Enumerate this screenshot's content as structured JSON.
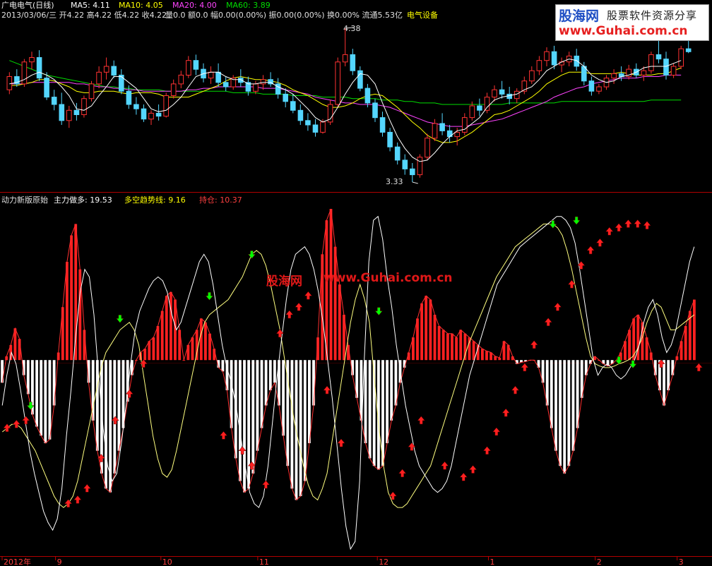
{
  "main_header": {
    "stock": "广电电气(日线)",
    "ma5_label": "MA5: 4.11",
    "ma10_label": "MA10: 4.05",
    "ma20_label": "MA20: 4.00",
    "ma60_label": "MA60: 3.89",
    "ohlc": "2013/03/06/三 开4.22 高4.22 低4.22 收4.22",
    "vol": "量0.0 额0.0 幅0.00(0.00%) 振0.00(0.00%) 换0.00% 流通5.53亿",
    "sector": "电气设备"
  },
  "price_annotations": {
    "high": "4.38",
    "low": "3.33"
  },
  "indicator_header": {
    "name": "动力新版原始",
    "main_label": "主力做多: 19.53",
    "trend_label": "多空趋势线: 9.16",
    "hold_label": "持仓: 10.37"
  },
  "watermark": {
    "cn": "股海网",
    "url": "www.Guhai.com.cn"
  },
  "logo": {
    "main": "股海网",
    "sub": "股票软件资源分享",
    "url": "www.Guhai.com.cn"
  },
  "colors": {
    "background": "#000000",
    "bull": "#ff3232",
    "bear": "#54d6ff",
    "ma5": "#ffffff",
    "ma10": "#ffff00",
    "ma20": "#ff44ff",
    "ma60": "#00dd00",
    "bar_pos": "#ff2020",
    "bar_neg": "#ffffff",
    "buy_arrow": "#ff2020",
    "sell_arrow": "#00ff00",
    "axis": "#c00000"
  },
  "chart_data": {
    "type": "line",
    "price_range": [
      3.33,
      4.38
    ],
    "x_axis_labels": [
      "2012年",
      "9",
      "10",
      "11",
      "12",
      "1",
      "2",
      "3"
    ],
    "candles": [
      [
        3.96,
        4.08,
        3.93,
        4.05
      ],
      [
        4.05,
        4.1,
        3.98,
        4.0
      ],
      [
        4.0,
        4.17,
        3.98,
        4.15
      ],
      [
        4.15,
        4.22,
        4.1,
        4.18
      ],
      [
        4.18,
        4.23,
        4.02,
        4.04
      ],
      [
        4.04,
        4.08,
        3.89,
        3.91
      ],
      [
        3.91,
        3.96,
        3.82,
        3.86
      ],
      [
        3.86,
        3.94,
        3.72,
        3.75
      ],
      [
        3.75,
        3.85,
        3.7,
        3.82
      ],
      [
        3.82,
        3.87,
        3.75,
        3.79
      ],
      [
        3.79,
        3.92,
        3.77,
        3.9
      ],
      [
        3.9,
        4.02,
        3.88,
        4.0
      ],
      [
        4.0,
        4.12,
        3.97,
        4.08
      ],
      [
        4.08,
        4.18,
        4.03,
        4.12
      ],
      [
        4.12,
        4.16,
        4.04,
        4.06
      ],
      [
        4.06,
        4.1,
        3.93,
        3.95
      ],
      [
        3.95,
        3.99,
        3.83,
        3.86
      ],
      [
        3.86,
        3.91,
        3.79,
        3.83
      ],
      [
        3.83,
        3.86,
        3.74,
        3.76
      ],
      [
        3.76,
        3.82,
        3.72,
        3.8
      ],
      [
        3.8,
        3.86,
        3.75,
        3.78
      ],
      [
        3.78,
        3.94,
        3.77,
        3.92
      ],
      [
        3.92,
        4.03,
        3.9,
        4.0
      ],
      [
        4.0,
        4.09,
        3.97,
        4.06
      ],
      [
        4.06,
        4.19,
        4.04,
        4.16
      ],
      [
        4.16,
        4.2,
        4.06,
        4.1
      ],
      [
        4.1,
        4.14,
        4.01,
        4.04
      ],
      [
        4.04,
        4.12,
        4.0,
        4.08
      ],
      [
        4.08,
        4.14,
        3.98,
        4.01
      ],
      [
        4.01,
        4.05,
        3.95,
        3.98
      ],
      [
        3.98,
        4.06,
        3.96,
        4.04
      ],
      [
        4.04,
        4.1,
        3.98,
        4.01
      ],
      [
        4.01,
        4.05,
        3.92,
        3.95
      ],
      [
        3.95,
        4.02,
        3.93,
        4.0
      ],
      [
        4.0,
        4.06,
        3.96,
        4.03
      ],
      [
        4.03,
        4.08,
        3.98,
        4.0
      ],
      [
        4.0,
        4.04,
        3.9,
        3.93
      ],
      [
        3.93,
        3.97,
        3.84,
        3.88
      ],
      [
        3.88,
        3.93,
        3.8,
        3.82
      ],
      [
        3.82,
        3.86,
        3.72,
        3.75
      ],
      [
        3.75,
        3.8,
        3.68,
        3.72
      ],
      [
        3.72,
        3.76,
        3.64,
        3.67
      ],
      [
        3.67,
        3.76,
        3.66,
        3.74
      ],
      [
        3.74,
        3.89,
        3.72,
        3.86
      ],
      [
        3.86,
        4.18,
        3.84,
        4.15
      ],
      [
        4.15,
        4.38,
        4.12,
        4.2
      ],
      [
        4.2,
        4.24,
        4.06,
        4.09
      ],
      [
        4.09,
        4.12,
        3.95,
        3.97
      ],
      [
        3.97,
        4.0,
        3.84,
        3.87
      ],
      [
        3.87,
        3.9,
        3.74,
        3.77
      ],
      [
        3.77,
        3.81,
        3.64,
        3.67
      ],
      [
        3.67,
        3.7,
        3.54,
        3.57
      ],
      [
        3.57,
        3.6,
        3.45,
        3.48
      ],
      [
        3.48,
        3.52,
        3.38,
        3.42
      ],
      [
        3.42,
        3.46,
        3.33,
        3.38
      ],
      [
        3.38,
        3.52,
        3.36,
        3.5
      ],
      [
        3.5,
        3.66,
        3.48,
        3.63
      ],
      [
        3.63,
        3.76,
        3.61,
        3.73
      ],
      [
        3.73,
        3.8,
        3.65,
        3.68
      ],
      [
        3.68,
        3.72,
        3.6,
        3.64
      ],
      [
        3.64,
        3.7,
        3.58,
        3.67
      ],
      [
        3.67,
        3.8,
        3.65,
        3.77
      ],
      [
        3.77,
        3.88,
        3.75,
        3.85
      ],
      [
        3.85,
        3.9,
        3.78,
        3.82
      ],
      [
        3.82,
        3.94,
        3.8,
        3.91
      ],
      [
        3.91,
        3.99,
        3.88,
        3.96
      ],
      [
        3.96,
        4.02,
        3.9,
        3.93
      ],
      [
        3.93,
        3.98,
        3.86,
        3.9
      ],
      [
        3.9,
        3.97,
        3.87,
        3.95
      ],
      [
        3.95,
        4.05,
        3.93,
        4.02
      ],
      [
        4.02,
        4.12,
        4.0,
        4.09
      ],
      [
        4.09,
        4.19,
        4.06,
        4.16
      ],
      [
        4.16,
        4.25,
        4.12,
        4.22
      ],
      [
        4.22,
        4.26,
        4.1,
        4.13
      ],
      [
        4.13,
        4.18,
        4.08,
        4.15
      ],
      [
        4.15,
        4.22,
        4.12,
        4.19
      ],
      [
        4.19,
        4.24,
        4.09,
        4.12
      ],
      [
        4.12,
        4.15,
        3.99,
        4.02
      ],
      [
        4.02,
        4.05,
        3.92,
        3.95
      ],
      [
        3.95,
        4.0,
        3.93,
        3.98
      ],
      [
        3.98,
        4.06,
        3.96,
        4.04
      ],
      [
        4.04,
        4.1,
        4.0,
        4.07
      ],
      [
        4.07,
        4.12,
        4.02,
        4.05
      ],
      [
        4.05,
        4.13,
        4.03,
        4.1
      ],
      [
        4.1,
        4.14,
        4.04,
        4.06
      ],
      [
        4.06,
        4.12,
        4.02,
        4.09
      ],
      [
        4.09,
        4.22,
        4.07,
        4.2
      ],
      [
        4.2,
        4.3,
        4.14,
        4.17
      ],
      [
        4.17,
        4.22,
        4.03,
        4.06
      ],
      [
        4.06,
        4.14,
        4.04,
        4.12
      ],
      [
        4.12,
        4.26,
        4.1,
        4.24
      ],
      [
        4.24,
        4.36,
        4.21,
        4.22
      ]
    ],
    "ma5": [
      4.0,
      4.01,
      4.03,
      4.06,
      4.08,
      4.06,
      4.03,
      3.98,
      3.92,
      3.83,
      3.82,
      3.85,
      3.92,
      3.98,
      4.05,
      4.05,
      4.01,
      3.97,
      3.9,
      3.83,
      3.81,
      3.82,
      3.86,
      3.91,
      3.98,
      4.05,
      4.07,
      4.08,
      4.08,
      4.05,
      4.03,
      4.03,
      4.0,
      4.0,
      4.01,
      4.01,
      3.98,
      3.96,
      3.93,
      3.88,
      3.83,
      3.77,
      3.74,
      3.76,
      3.84,
      3.93,
      4.01,
      4.07,
      4.06,
      4.0,
      3.87,
      3.75,
      3.64,
      3.56,
      3.5,
      3.47,
      3.48,
      3.53,
      3.59,
      3.64,
      3.68,
      3.69,
      3.73,
      3.77,
      3.84,
      3.89,
      3.91,
      3.92,
      3.93,
      3.96,
      3.98,
      4.03,
      4.09,
      4.12,
      4.15,
      4.17,
      4.16,
      4.12,
      4.06,
      4.03,
      4.01,
      4.02,
      4.05,
      4.06,
      4.08,
      4.11,
      4.12,
      4.12,
      4.12,
      4.14,
      4.16
    ],
    "ma10": [
      3.99,
      3.99,
      4.0,
      4.01,
      4.03,
      4.03,
      4.02,
      4.0,
      3.98,
      3.95,
      3.94,
      3.94,
      3.95,
      3.95,
      3.95,
      3.94,
      3.93,
      3.94,
      3.94,
      3.94,
      3.93,
      3.91,
      3.91,
      3.91,
      3.91,
      3.93,
      3.95,
      3.97,
      3.99,
      4.02,
      4.04,
      4.05,
      4.04,
      4.03,
      4.03,
      4.02,
      4.01,
      3.99,
      3.96,
      3.94,
      3.92,
      3.89,
      3.86,
      3.84,
      3.84,
      3.85,
      3.87,
      3.9,
      3.92,
      3.93,
      3.92,
      3.88,
      3.84,
      3.79,
      3.74,
      3.7,
      3.65,
      3.62,
      3.6,
      3.6,
      3.61,
      3.64,
      3.67,
      3.71,
      3.75,
      3.79,
      3.8,
      3.82,
      3.85,
      3.88,
      3.91,
      3.95,
      4.0,
      4.03,
      4.06,
      4.08,
      4.08,
      4.08,
      4.07,
      4.07,
      4.07,
      4.07,
      4.08,
      4.07,
      4.06,
      4.06,
      4.06,
      4.07,
      4.07,
      4.09,
      4.11
    ],
    "ma20": [
      4.0,
      4.0,
      4.0,
      4.01,
      4.01,
      4.01,
      4.01,
      4.01,
      4.01,
      4.0,
      4.0,
      3.99,
      3.98,
      3.98,
      3.97,
      3.97,
      3.96,
      3.96,
      3.95,
      3.95,
      3.95,
      3.95,
      3.95,
      3.95,
      3.96,
      3.96,
      3.97,
      3.97,
      3.98,
      3.98,
      3.98,
      3.98,
      3.98,
      3.98,
      3.97,
      3.97,
      3.97,
      3.96,
      3.95,
      3.94,
      3.93,
      3.91,
      3.9,
      3.89,
      3.88,
      3.87,
      3.87,
      3.86,
      3.86,
      3.86,
      3.85,
      3.84,
      3.82,
      3.8,
      3.78,
      3.76,
      3.74,
      3.73,
      3.72,
      3.71,
      3.71,
      3.71,
      3.72,
      3.73,
      3.74,
      3.75,
      3.76,
      3.78,
      3.8,
      3.82,
      3.84,
      3.86,
      3.88,
      3.91,
      3.93,
      3.95,
      3.97,
      3.98,
      4.0,
      4.01,
      4.02,
      4.03,
      4.04,
      4.04,
      4.04,
      4.05,
      4.05,
      4.05,
      4.06,
      4.06,
      4.06
    ],
    "ma60": [
      4.16,
      4.14,
      4.12,
      4.1,
      4.08,
      4.06,
      4.05,
      4.04,
      4.03,
      4.02,
      4.01,
      4.0,
      3.99,
      3.98,
      3.98,
      3.97,
      3.97,
      3.96,
      3.96,
      3.96,
      3.96,
      3.95,
      3.95,
      3.95,
      3.95,
      3.95,
      3.95,
      3.95,
      3.95,
      3.95,
      3.94,
      3.94,
      3.94,
      3.94,
      3.93,
      3.93,
      3.93,
      3.93,
      3.92,
      3.92,
      3.92,
      3.92,
      3.91,
      3.91,
      3.91,
      3.91,
      3.9,
      3.9,
      3.9,
      3.9,
      3.89,
      3.89,
      3.89,
      3.88,
      3.88,
      3.87,
      3.87,
      3.87,
      3.86,
      3.86,
      3.86,
      3.86,
      3.86,
      3.86,
      3.86,
      3.86,
      3.86,
      3.87,
      3.87,
      3.87,
      3.87,
      3.87,
      3.87,
      3.87,
      3.88,
      3.88,
      3.88,
      3.88,
      3.88,
      3.88,
      3.88,
      3.88,
      3.88,
      3.88,
      3.88,
      3.88,
      3.89,
      3.89,
      3.89,
      3.89,
      3.89
    ],
    "ind_range": [
      -250,
      200
    ],
    "histogram": [
      -30,
      5,
      20,
      42,
      28,
      -20,
      -45,
      -72,
      -88,
      -100,
      -110,
      -105,
      -60,
      10,
      70,
      130,
      165,
      180,
      120,
      40,
      -30,
      -80,
      -120,
      -150,
      -170,
      -175,
      -150,
      -120,
      -90,
      -55,
      -20,
      0,
      10,
      15,
      25,
      30,
      45,
      65,
      85,
      90,
      80,
      40,
      0,
      20,
      30,
      40,
      55,
      50,
      35,
      15,
      -10,
      -15,
      -40,
      -90,
      -130,
      -160,
      -175,
      -170,
      -150,
      -120,
      -90,
      -60,
      -40,
      -30,
      -60,
      -100,
      -140,
      -170,
      -185,
      -180,
      -160,
      -110,
      -60,
      30,
      140,
      185,
      200,
      150,
      100,
      60,
      20,
      -20,
      -50,
      -80,
      -110,
      -130,
      -140,
      -145,
      -140,
      -110,
      -80,
      -60,
      -30,
      -10,
      10,
      30,
      55,
      75,
      85,
      80,
      60,
      45,
      40,
      35,
      35,
      30,
      40,
      35,
      30,
      25,
      20,
      15,
      12,
      10,
      5,
      3,
      25,
      20,
      5,
      -5,
      -3,
      -2,
      0,
      0,
      -10,
      -30,
      -60,
      -90,
      -120,
      -140,
      -150,
      -140,
      -120,
      -90,
      -50,
      -20,
      -5,
      5,
      0,
      -5,
      -8,
      -5,
      0,
      10,
      25,
      40,
      55,
      60,
      50,
      30,
      10,
      -20,
      -40,
      -60,
      -40,
      -20,
      5,
      25,
      45,
      65,
      80
    ],
    "main_line": [
      -60,
      -20,
      10,
      -5,
      -40,
      -80,
      -120,
      -150,
      -175,
      -200,
      -215,
      -225,
      -210,
      -170,
      -100,
      -40,
      30,
      90,
      120,
      110,
      60,
      -20,
      -90,
      -140,
      -160,
      -150,
      -110,
      -60,
      -5,
      40,
      65,
      80,
      95,
      105,
      110,
      105,
      90,
      60,
      40,
      50,
      70,
      90,
      110,
      130,
      140,
      130,
      100,
      60,
      20,
      -10,
      -30,
      -60,
      -100,
      -140,
      -175,
      -190,
      -195,
      -180,
      -140,
      -80,
      -20,
      30,
      80,
      120,
      140,
      145,
      150,
      140,
      120,
      90,
      50,
      0,
      -50,
      -110,
      -170,
      -220,
      -250,
      -240,
      -160,
      0,
      130,
      185,
      190,
      160,
      110,
      70,
      20,
      -20,
      -60,
      -90,
      -120,
      -140,
      -150,
      -160,
      -170,
      -175,
      -170,
      -160,
      -140,
      -110,
      -80,
      -50,
      -20,
      0,
      20,
      40,
      60,
      80,
      100,
      110,
      120,
      130,
      140,
      150,
      155,
      160,
      165,
      170,
      175,
      180,
      185,
      190,
      190,
      185,
      175,
      155,
      120,
      80,
      40,
      0,
      -20,
      -10,
      -5,
      -10,
      -20,
      -25,
      -20,
      -10,
      0,
      20,
      50,
      70,
      80,
      60,
      30,
      10,
      20,
      40,
      70,
      100,
      130,
      150
    ],
    "trend_line": [
      -95,
      -90,
      -85,
      -85,
      -90,
      -100,
      -110,
      -120,
      -135,
      -150,
      -165,
      -180,
      -190,
      -195,
      -190,
      -180,
      -160,
      -130,
      -100,
      -70,
      -40,
      -10,
      10,
      20,
      30,
      40,
      45,
      50,
      40,
      20,
      -20,
      -60,
      -100,
      -130,
      -150,
      -155,
      -145,
      -120,
      -90,
      -60,
      -30,
      0,
      30,
      50,
      60,
      65,
      70,
      75,
      80,
      90,
      100,
      110,
      125,
      140,
      145,
      140,
      125,
      100,
      70,
      40,
      0,
      -40,
      -80,
      -110,
      -140,
      -165,
      -180,
      -185,
      -170,
      -150,
      -110,
      -70,
      -30,
      10,
      50,
      80,
      100,
      80,
      50,
      -20,
      -90,
      -140,
      -175,
      -190,
      -195,
      -195,
      -190,
      -180,
      -170,
      -160,
      -150,
      -140,
      -120,
      -100,
      -80,
      -60,
      -40,
      -20,
      0,
      20,
      35,
      50,
      65,
      80,
      95,
      110,
      120,
      130,
      140,
      150,
      155,
      160,
      165,
      170,
      175,
      180,
      180,
      180,
      175,
      165,
      145,
      120,
      90,
      60,
      30,
      5,
      -5,
      -8,
      -10,
      -10,
      -8,
      -5,
      -3,
      0,
      5,
      15,
      30,
      50,
      65,
      75,
      70,
      55,
      40,
      40,
      45,
      50,
      55,
      60
    ],
    "buy_signals": [
      [
        1,
        -90
      ],
      [
        3,
        -85
      ],
      [
        5,
        -80
      ],
      [
        14,
        -190
      ],
      [
        16,
        -185
      ],
      [
        18,
        -170
      ],
      [
        21,
        -130
      ],
      [
        24,
        -80
      ],
      [
        27,
        -45
      ],
      [
        30,
        -5
      ],
      [
        47,
        -100
      ],
      [
        51,
        -120
      ],
      [
        53,
        -140
      ],
      [
        56,
        -165
      ],
      [
        59,
        35
      ],
      [
        61,
        60
      ],
      [
        63,
        70
      ],
      [
        65,
        85
      ],
      [
        69,
        -40
      ],
      [
        72,
        -110
      ],
      [
        83,
        -180
      ],
      [
        85,
        -150
      ],
      [
        87,
        -115
      ],
      [
        89,
        -80
      ],
      [
        94,
        -140
      ],
      [
        98,
        -155
      ],
      [
        100,
        -145
      ],
      [
        103,
        -120
      ],
      [
        105,
        -95
      ],
      [
        107,
        -70
      ],
      [
        109,
        -40
      ],
      [
        111,
        -10
      ],
      [
        113,
        20
      ],
      [
        116,
        50
      ],
      [
        118,
        70
      ],
      [
        121,
        100
      ],
      [
        123,
        125
      ],
      [
        125,
        145
      ],
      [
        127,
        155
      ],
      [
        129,
        170
      ],
      [
        131,
        175
      ],
      [
        133,
        180
      ],
      [
        135,
        180
      ],
      [
        137,
        178
      ],
      [
        140,
        -5
      ],
      [
        148,
        -10
      ],
      [
        153,
        15
      ],
      [
        157,
        35
      ],
      [
        160,
        55
      ],
      [
        162,
        60
      ],
      [
        165,
        50
      ],
      [
        168,
        40
      ],
      [
        170,
        45
      ]
    ],
    "sell_signals": [
      [
        6,
        -60
      ],
      [
        25,
        55
      ],
      [
        44,
        85
      ],
      [
        53,
        140
      ],
      [
        80,
        65
      ],
      [
        117,
        180
      ],
      [
        122,
        185
      ],
      [
        131,
        0
      ],
      [
        134,
        -5
      ],
      [
        152,
        75
      ]
    ]
  }
}
